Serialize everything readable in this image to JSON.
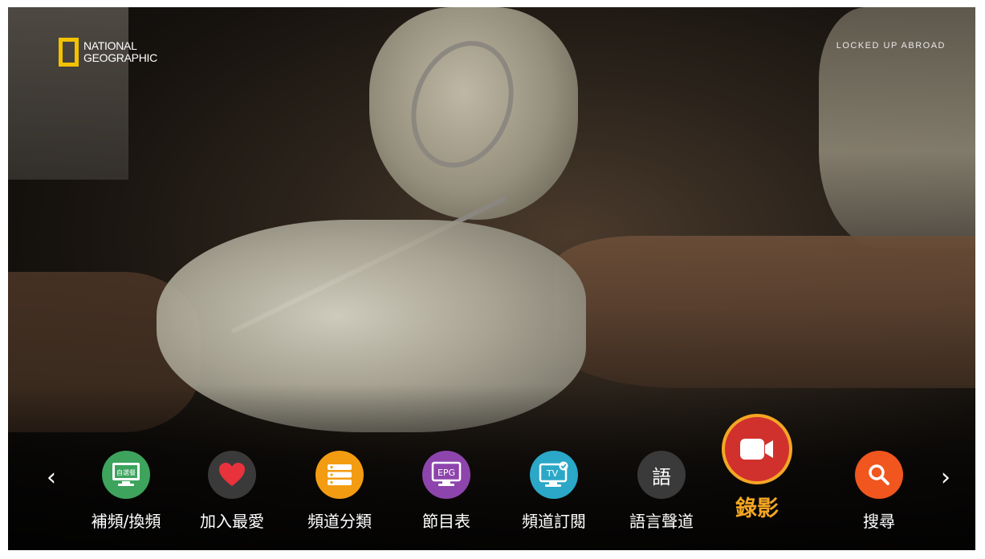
{
  "logo": {
    "line1": "NATIONAL",
    "line2": "GEOGRAPHIC",
    "frame_color": "#F2C200"
  },
  "program_title": "LOCKED UP ABROAD",
  "nav": {
    "prev_icon": "chevron-left-icon",
    "next_icon": "chevron-right-icon",
    "prev_glyph": "‹",
    "next_glyph": "›"
  },
  "menu": {
    "items": [
      {
        "label": "補頻/換頻",
        "icon": "monitor-icon",
        "icon_text": "自選餐",
        "color": "#3DA35D",
        "selected": false
      },
      {
        "label": "加入最愛",
        "icon": "heart-icon",
        "color": "#3A3A3A",
        "selected": false
      },
      {
        "label": "頻道分類",
        "icon": "list-icon",
        "color": "#F39C12",
        "selected": false
      },
      {
        "label": "節目表",
        "icon": "epg-icon",
        "icon_text": "EPG",
        "color": "#8E44AD",
        "selected": false
      },
      {
        "label": "頻道訂閱",
        "icon": "tv-subscribe-icon",
        "icon_text": "TV",
        "color": "#2BA7C7",
        "selected": false
      },
      {
        "label": "語言聲道",
        "icon": "language-icon",
        "icon_text": "語",
        "color": "#3A3A3A",
        "selected": false
      },
      {
        "label": "錄影",
        "icon": "video-camera-icon",
        "color": "#D0312D",
        "selected": true
      },
      {
        "label": "搜尋",
        "icon": "search-icon",
        "color": "#F0561E",
        "selected": false
      }
    ]
  }
}
